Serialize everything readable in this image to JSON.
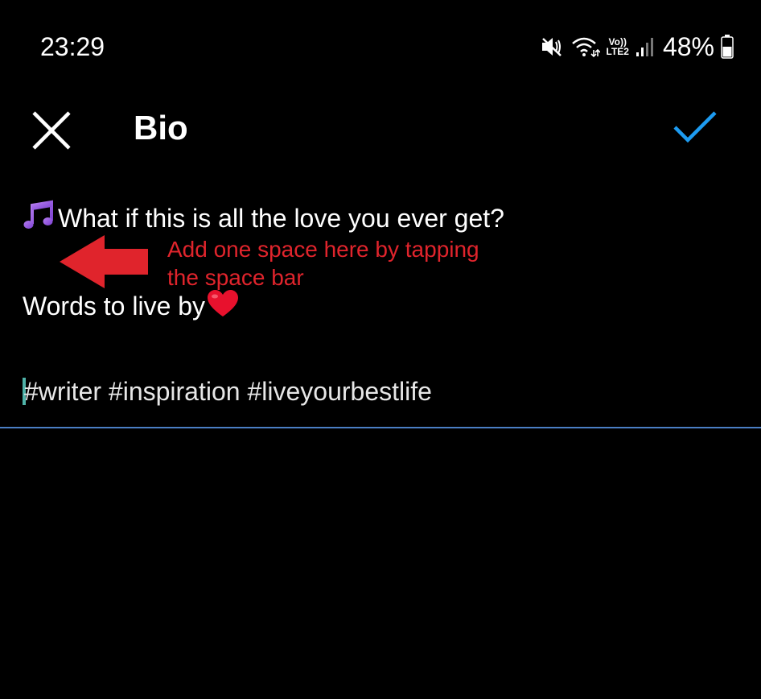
{
  "status_bar": {
    "time": "23:29",
    "volte_label": "Vo))",
    "lte_label": "LTE2",
    "battery": "48%",
    "icons": [
      "mute-icon",
      "wifi-icon",
      "signal-icon",
      "battery-icon"
    ]
  },
  "app_bar": {
    "title": "Bio",
    "close_icon": "close-icon",
    "confirm_icon": "check-icon",
    "accent_color": "#1d9bf0"
  },
  "bio": {
    "line1_text": "What if this is all the love you ever get?",
    "line2_text": "Words to live by",
    "line3_text": "#writer #inspiration #liveyourbestlife",
    "line1_emoji": "music-note-icon",
    "line2_emoji": "red-heart-icon"
  },
  "annotation": {
    "line1": "Add one space here by tapping",
    "line2": "the space bar",
    "color": "#e0242c"
  }
}
